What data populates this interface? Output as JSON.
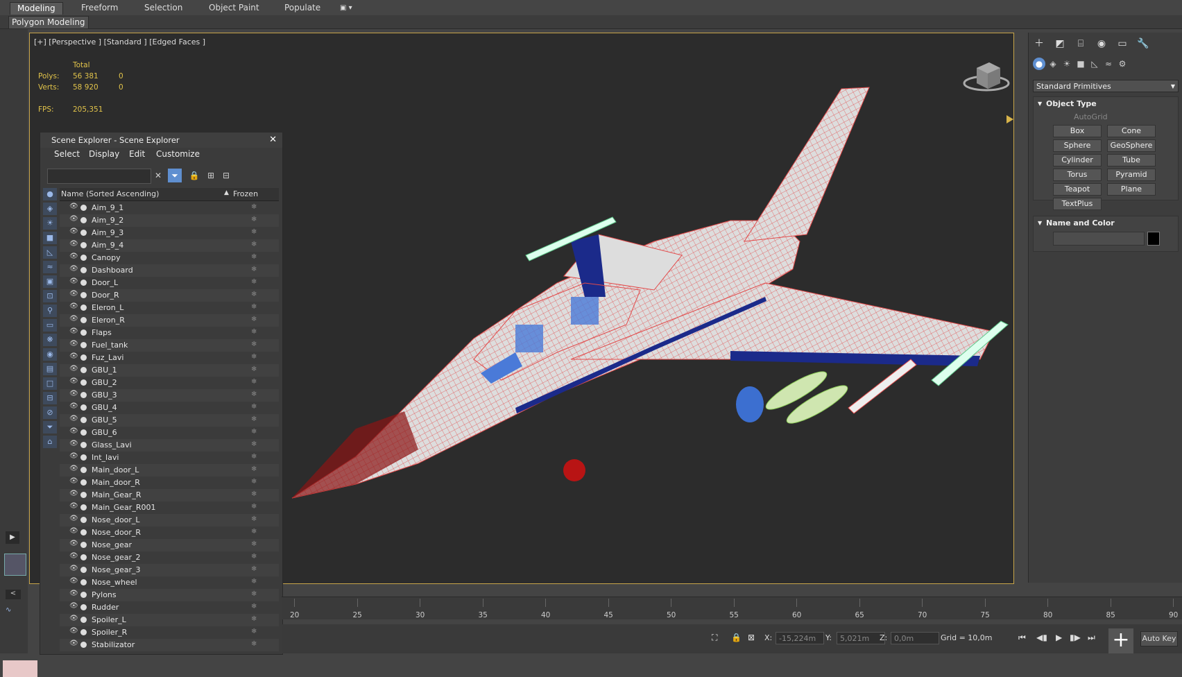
{
  "ribbon": {
    "tabs": [
      "Modeling",
      "Freeform",
      "Selection",
      "Object Paint",
      "Populate"
    ],
    "active_tab": "Modeling",
    "subtab": "Polygon Modeling"
  },
  "viewport": {
    "label": "[+] [Perspective ] [Standard ] [Edged Faces ]",
    "stats": {
      "total_header": "Total",
      "polys_label": "Polys:",
      "polys_total": "56 381",
      "polys_sel": "0",
      "verts_label": "Verts:",
      "verts_total": "58 920",
      "verts_sel": "0",
      "fps_label": "FPS:",
      "fps_value": "205,351"
    }
  },
  "scene_explorer": {
    "title": "Scene Explorer - Scene Explorer",
    "menu": [
      "Select",
      "Display",
      "Edit",
      "Customize"
    ],
    "columns": {
      "name": "Name (Sorted Ascending)",
      "frozen": "Frozen"
    },
    "objects": [
      "Aim_9_1",
      "Aim_9_2",
      "Aim_9_3",
      "Aim_9_4",
      "Canopy",
      "Dashboard",
      "Door_L",
      "Door_R",
      "Eleron_L",
      "Eleron_R",
      "Flaps",
      "Fuel_tank",
      "Fuz_Lavi",
      "GBU_1",
      "GBU_2",
      "GBU_3",
      "GBU_4",
      "GBU_5",
      "GBU_6",
      "Glass_Lavi",
      "Int_lavi",
      "Main_door_L",
      "Main_door_R",
      "Main_Gear_R",
      "Main_Gear_R001",
      "Nose_door_L",
      "Nose_door_R",
      "Nose_gear",
      "Nose_gear_2",
      "Nose_gear_3",
      "Nose_wheel",
      "Pylons",
      "Rudder",
      "Spoiler_L",
      "Spoiler_R",
      "Stabilizator"
    ]
  },
  "command_panel": {
    "category": "Standard Primitives",
    "object_type_title": "Object Type",
    "autogrid": "AutoGrid",
    "primitives": [
      "Box",
      "Cone",
      "Sphere",
      "GeoSphere",
      "Cylinder",
      "Tube",
      "Torus",
      "Pyramid",
      "Teapot",
      "Plane",
      "TextPlus"
    ],
    "name_color_title": "Name and Color"
  },
  "timeline": {
    "ticks": [
      "20",
      "25",
      "30",
      "35",
      "40",
      "45",
      "50",
      "55",
      "60",
      "65",
      "70",
      "75",
      "80",
      "85",
      "90"
    ]
  },
  "status": {
    "x_label": "X:",
    "x_value": "-15,224m",
    "y_label": "Y:",
    "y_value": "5,021m",
    "z_label": "Z:",
    "z_value": "0,0m",
    "grid": "Grid = 10,0m",
    "autokey": "Auto Key"
  }
}
